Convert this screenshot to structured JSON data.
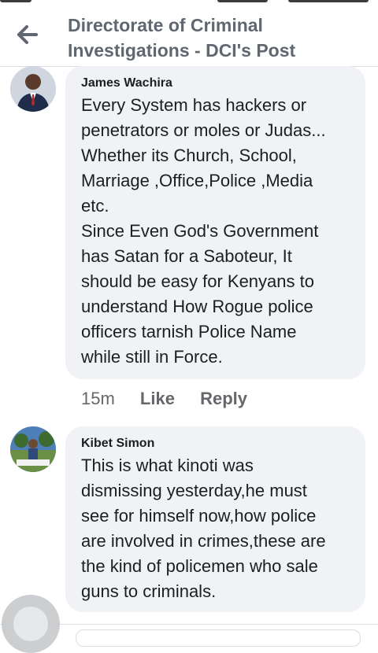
{
  "header": {
    "title": "Directorate of Criminal Investigations - DCI's Post",
    "back_icon": "arrow-left-icon"
  },
  "comments": [
    {
      "author": "James Wachira",
      "text": "Every System has hackers or\npenetrators or moles or Judas...\nWhether its Church, School,\nMarriage ,Office,Police ,Media\netc.\nSince Even God's Government\nhas Satan for a Saboteur, It\nshould be easy for Kenyans to\nunderstand How Rogue police\nofficers tarnish Police Name\nwhile still in Force.",
      "time": "15m",
      "like_label": "Like",
      "reply_label": "Reply"
    },
    {
      "author": "Kibet Simon",
      "text": "This is what kinoti was\ndismissing yesterday,he must\nsee for himself now,how police\nare involved in crimes,these are\nthe kind of policemen who sale\nguns to criminals."
    }
  ],
  "colors": {
    "bubble": "#f0f2f5",
    "header_text": "#606770",
    "meta_text": "#65676b"
  }
}
